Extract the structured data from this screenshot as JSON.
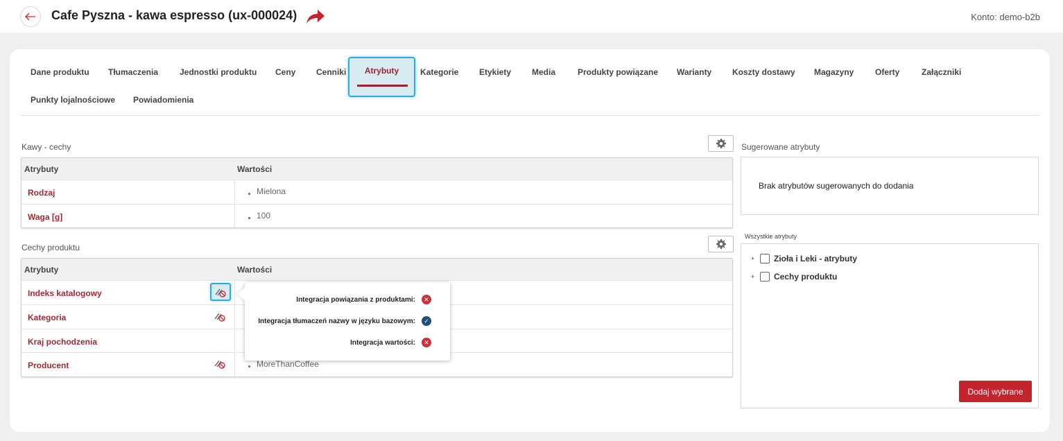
{
  "header": {
    "title": "Cafe Pyszna - kawa espresso (ux-000024)",
    "account": "Konto: demo-b2b"
  },
  "tabs": [
    {
      "label": "Dane produktu"
    },
    {
      "label": "Tłumaczenia"
    },
    {
      "label": "Jednostki produktu"
    },
    {
      "label": "Ceny"
    },
    {
      "label": "Cenniki"
    },
    {
      "label": "Atrybuty",
      "active": true
    },
    {
      "label": "Kategorie"
    },
    {
      "label": "Etykiety"
    },
    {
      "label": "Media"
    },
    {
      "label": "Produkty powiązane"
    },
    {
      "label": "Warianty"
    },
    {
      "label": "Koszty dostawy"
    },
    {
      "label": "Magazyny"
    },
    {
      "label": "Oferty"
    },
    {
      "label": "Załączniki"
    },
    {
      "label": "Punkty lojalnościowe"
    },
    {
      "label": "Powiadomienia"
    }
  ],
  "group1": {
    "title": "Kawy - cechy",
    "col_attr": "Atrybuty",
    "col_val": "Wartości",
    "rows": [
      {
        "name": "Rodzaj",
        "value": "Mielona"
      },
      {
        "name": "Waga [g]",
        "value": "100"
      }
    ]
  },
  "group2": {
    "title": "Cechy produktu",
    "col_attr": "Atrybuty",
    "col_val": "Wartości",
    "rows": [
      {
        "name": "Indeks katalogowy",
        "value": ""
      },
      {
        "name": "Kategoria",
        "value": ""
      },
      {
        "name": "Kraj pochodzenia",
        "value": ""
      },
      {
        "name": "Producent",
        "value": "MoreThanCoffee"
      }
    ]
  },
  "tooltip": {
    "lines": [
      {
        "label": "Integracja powiązania z produktami:",
        "status": "no"
      },
      {
        "label": "Integracja tłumaczeń nazwy w języku bazowym:",
        "status": "yes"
      },
      {
        "label": "Integracja wartości:",
        "status": "no"
      }
    ]
  },
  "suggested": {
    "title": "Sugerowane atrybuty",
    "empty": "Brak atrybutów sugerowanych do dodania"
  },
  "all_attributes": {
    "title": "Wszystkie atrybuty",
    "items": [
      {
        "label": "Zioła i Leki - atrybuty"
      },
      {
        "label": "Cechy produktu"
      }
    ],
    "add_button": "Dodaj wybrane"
  },
  "colors": {
    "accent_red": "#a02a35",
    "button_red": "#c4242e",
    "highlight_blue": "#29abe2",
    "check_blue": "#1f4f7a"
  },
  "icons": {
    "back": "arrow-left-icon",
    "share": "share-arrow-icon",
    "settings": "gear-icon",
    "integration": "unlink-icon"
  }
}
